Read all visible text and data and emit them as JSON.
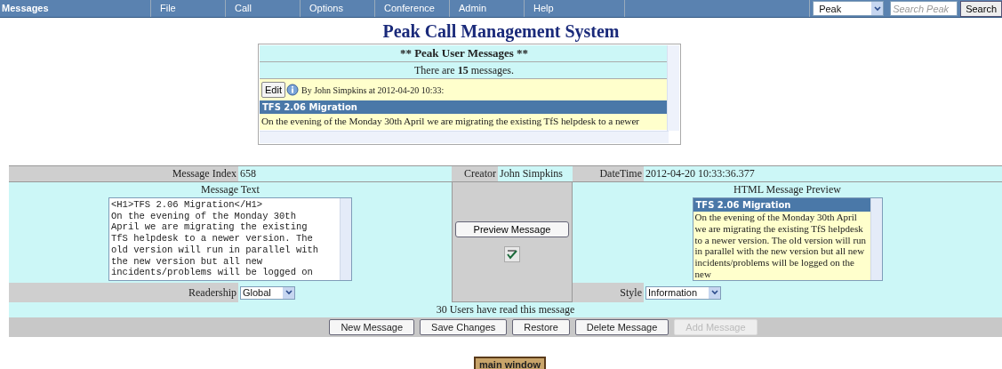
{
  "menu": [
    {
      "label": "Messages",
      "selected": true
    },
    {
      "label": "File",
      "selected": false
    },
    {
      "label": "Call",
      "selected": false
    },
    {
      "label": "Options",
      "selected": false
    },
    {
      "label": "Conference",
      "selected": false
    },
    {
      "label": "Admin",
      "selected": false
    },
    {
      "label": "Help",
      "selected": false
    }
  ],
  "site_select": "Peak",
  "search": {
    "placeholder": "Search Peak",
    "button": "Search"
  },
  "page_title": "Peak Call Management System",
  "messages_panel": {
    "heading": "** Peak User Messages **",
    "count_text": "There are **15** messages.",
    "edit_button": "Edit",
    "byline": "By John Simpkins at 2012-04-20 10:33:",
    "message_title": "TFS 2.06 Migration",
    "message_body": "On the evening of the Monday 30th April we are migrating the existing TfS helpdesk to a newer"
  },
  "form": {
    "index_label": "Message Index",
    "index_value": "658",
    "creator_label": "Creator",
    "creator_value": "John Simpkins",
    "datetime_label": "DateTime",
    "datetime_value": "2012-04-20 10:33:36.377",
    "text_label": "Message Text",
    "text_value": "<H1>TFS 2.06 Migration</H1>\nOn the evening of the Monday 30th\nApril we are migrating the existing\nTfS helpdesk to a newer version. The\nold version will run in parallel with\nthe new version but all new\nincidents/problems will be logged on",
    "preview_button": "Preview Message",
    "preview_label": "HTML Message Preview",
    "preview_title": "TFS 2.06 Migration",
    "preview_body": "On the evening of the Monday 30th April we are migrating the existing TfS helpdesk to a newer version. The old version will run in parallel with the new version but all new incidents/problems will be logged on the new",
    "readership_label": "Readership",
    "readership_value": "Global",
    "style_label": "Style",
    "style_value": "Information",
    "read_count": "30 Users have read this message"
  },
  "actions": [
    {
      "label": "New Message",
      "disabled": false
    },
    {
      "label": "Save Changes",
      "disabled": false
    },
    {
      "label": "Restore",
      "disabled": false
    },
    {
      "label": "Delete Message",
      "disabled": false
    },
    {
      "label": "Add Message",
      "disabled": true
    }
  ],
  "footer_button": "main window"
}
